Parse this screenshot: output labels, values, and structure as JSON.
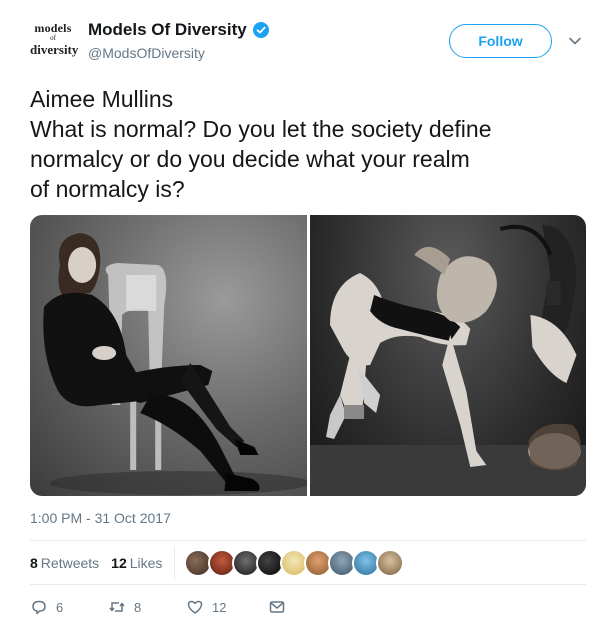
{
  "account": {
    "logo_line1": "models",
    "logo_line2": "of",
    "logo_line3": "diversity",
    "display_name": "Models Of Diversity",
    "handle": "@ModsOfDiversity",
    "verified": true
  },
  "header": {
    "follow_label": "Follow"
  },
  "tweet": {
    "lines": [
      "Aimee Mullins",
      "What is normal? Do you let the society define",
      "normalcy or do you decide what your realm",
      "of normalcy is?"
    ],
    "timestamp": "1:00 PM - 31 Oct 2017"
  },
  "stats": {
    "retweets_count": "8",
    "retweets_label": "Retweets",
    "likes_count": "12",
    "likes_label": "Likes"
  },
  "actions": {
    "reply_count": "6",
    "retweet_count": "8",
    "like_count": "12"
  },
  "colors": {
    "accent": "#1da1f2",
    "secondary_text": "#657786",
    "divider": "#e6ecf0"
  },
  "icons": [
    "verified-icon",
    "chevron-down-icon",
    "reply-icon",
    "retweet-icon",
    "like-icon",
    "message-icon"
  ]
}
